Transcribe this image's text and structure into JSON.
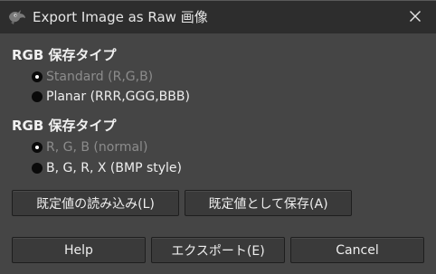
{
  "window": {
    "title": "Export Image as Raw 画像",
    "close_glyph": "✕",
    "icon": "gimp-wilber-icon"
  },
  "sections": [
    {
      "header": "RGB 保存タイプ",
      "options": [
        {
          "label": "Standard (R,G,B)",
          "selected": true
        },
        {
          "label": "Planar (RRR,GGG,BBB)",
          "selected": false
        }
      ]
    },
    {
      "header": "RGB 保存タイプ",
      "options": [
        {
          "label": "R, G, B (normal)",
          "selected": true
        },
        {
          "label": "B, G, R, X (BMP style)",
          "selected": false
        }
      ]
    }
  ],
  "defaults_buttons": {
    "load": "既定値の読み込み(L)",
    "save": "既定値として保存(A)"
  },
  "action_buttons": {
    "help": "Help",
    "export": "エクスポート(E)",
    "cancel": "Cancel"
  },
  "colors": {
    "background": "#454545",
    "titlebar": "#2d2d2d",
    "button": "#3a3a3a",
    "text": "#eeeeee",
    "dim_text": "#8c8c8c"
  }
}
